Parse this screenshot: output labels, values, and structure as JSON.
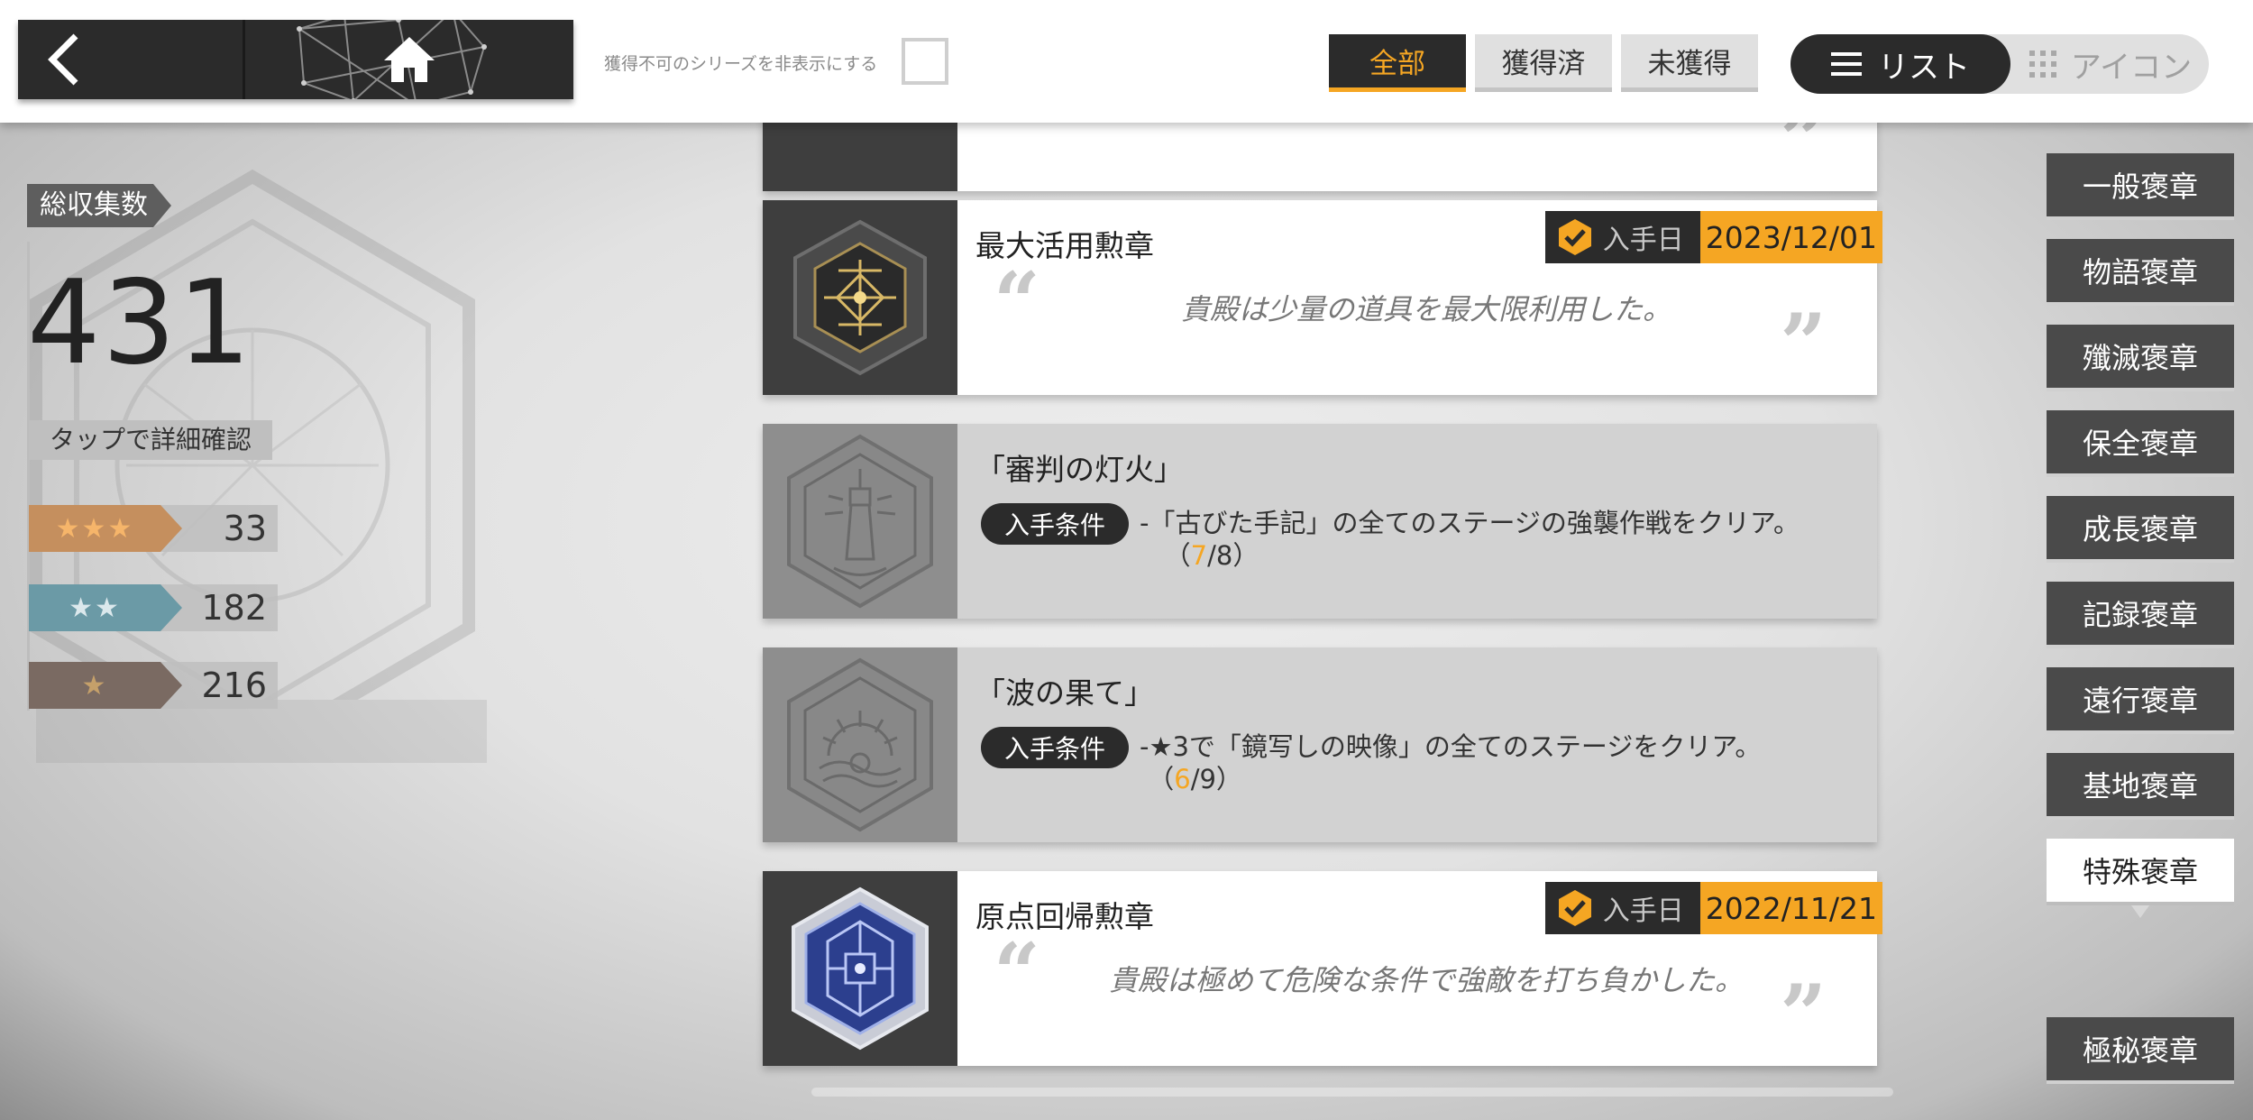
{
  "header": {
    "hide_unobtainable_label": "獲得不可のシリーズを非表示にする",
    "filter_tabs": [
      {
        "label": "全部",
        "active": true
      },
      {
        "label": "獲得済",
        "active": false
      },
      {
        "label": "未獲得",
        "active": false
      }
    ],
    "view_toggle": {
      "list": "リスト",
      "icon": "アイコン",
      "active": "list"
    }
  },
  "stats": {
    "total_label": "総収集数",
    "total_value": "431",
    "detail_button": "タップで詳細確認",
    "rarities": [
      {
        "stars": "★★★",
        "count": "33",
        "color": "#c58f5e"
      },
      {
        "stars": "★★",
        "count": "182",
        "color": "#6b9aa6"
      },
      {
        "stars": "★",
        "count": "216",
        "color": "#7a6a62"
      }
    ]
  },
  "list": {
    "date_label": "入手日",
    "condition_label": "入手条件",
    "cards": [
      {
        "name": "最大活用勲章",
        "date": "2023/12/01",
        "description": "貴殿は少量の道具を最大限利用した。",
        "obtained": true
      },
      {
        "name": "「審判の灯火」",
        "condition": "-「古びた手記」の全てのステージの強襲作戦をクリア。",
        "progress_current": "7",
        "progress_total": "/8）",
        "progress_open": "（",
        "obtained": false
      },
      {
        "name": "「波の果て」",
        "condition": "-★3で「鏡写しの映像」の全てのステージをクリア。",
        "progress_current": "6",
        "progress_total": "/9）",
        "progress_open": "（",
        "obtained": false
      },
      {
        "name": "原点回帰勲章",
        "date": "2022/11/21",
        "description": "貴殿は極めて危険な条件で強敵を打ち負かした。",
        "obtained": true
      }
    ]
  },
  "categories": [
    {
      "label": "一般褒章",
      "active": false
    },
    {
      "label": "物語褒章",
      "active": false
    },
    {
      "label": "殲滅褒章",
      "active": false
    },
    {
      "label": "保全褒章",
      "active": false
    },
    {
      "label": "成長褒章",
      "active": false
    },
    {
      "label": "記録褒章",
      "active": false
    },
    {
      "label": "遠行褒章",
      "active": false
    },
    {
      "label": "基地褒章",
      "active": false
    },
    {
      "label": "特殊褒章",
      "active": true
    },
    {
      "label": "極秘褒章",
      "active": false
    }
  ],
  "colors": {
    "accent": "#f5a623",
    "dark": "#2b2b2b"
  }
}
